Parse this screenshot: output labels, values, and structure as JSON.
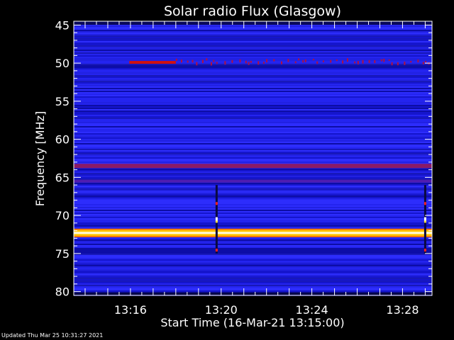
{
  "chart_data": {
    "type": "heatmap",
    "title": "Solar radio Flux (Glasgow)",
    "xlabel": "Start Time (16-Mar-21 13:15:00)",
    "ylabel": "Frequency [MHz]",
    "x_range_minutes": [
      13.5,
      29.3
    ],
    "y_range_mhz": [
      44.5,
      80.5
    ],
    "y_axis_direction": "increasing-downward",
    "x_ticks": [
      {
        "label": "13:16",
        "minute": 16
      },
      {
        "label": "13:20",
        "minute": 20
      },
      {
        "label": "13:24",
        "minute": 24
      },
      {
        "label": "13:28",
        "minute": 28
      }
    ],
    "y_ticks": [
      {
        "label": "45",
        "mhz": 45
      },
      {
        "label": "50",
        "mhz": 50
      },
      {
        "label": "55",
        "mhz": 55
      },
      {
        "label": "60",
        "mhz": 60
      },
      {
        "label": "65",
        "mhz": 65
      },
      {
        "label": "70",
        "mhz": 70
      },
      {
        "label": "75",
        "mhz": 75
      },
      {
        "label": "80",
        "mhz": 80
      }
    ],
    "background_color": "#1f1fe6",
    "colorscale": [
      "#00006e",
      "#1414c8",
      "#3a3aff",
      "#8a0050",
      "#ff2000",
      "#ffc800",
      "#ffffff"
    ],
    "features": [
      {
        "kind": "band",
        "freq_mhz": 72.3,
        "intensity": "very-high",
        "color": "#ffe040"
      },
      {
        "kind": "band",
        "freq_mhz": 63.5,
        "intensity": "medium",
        "color": "#8a1a66"
      },
      {
        "kind": "band",
        "freq_mhz": 65.5,
        "intensity": "low",
        "color": "#5a1aa0"
      },
      {
        "kind": "segment",
        "freq_mhz": 49.9,
        "start_minute": 15.95,
        "end_minute": 18.0,
        "color": "#d01010"
      },
      {
        "kind": "dotted-band",
        "freq_mhz": 49.8,
        "start_minute": 18.0,
        "end_minute": 29.3,
        "color": "#b01040"
      },
      {
        "kind": "spike",
        "minute": 19.8,
        "freq_start_mhz": 66.0,
        "freq_end_mhz": 75.0,
        "color": "#ff3010"
      },
      {
        "kind": "spike",
        "minute": 29.0,
        "freq_start_mhz": 66.0,
        "freq_end_mhz": 75.0,
        "color": "#ff3010"
      }
    ]
  },
  "footer": {
    "updated": "Updated Thu Mar 25 10:31:27 2021"
  }
}
